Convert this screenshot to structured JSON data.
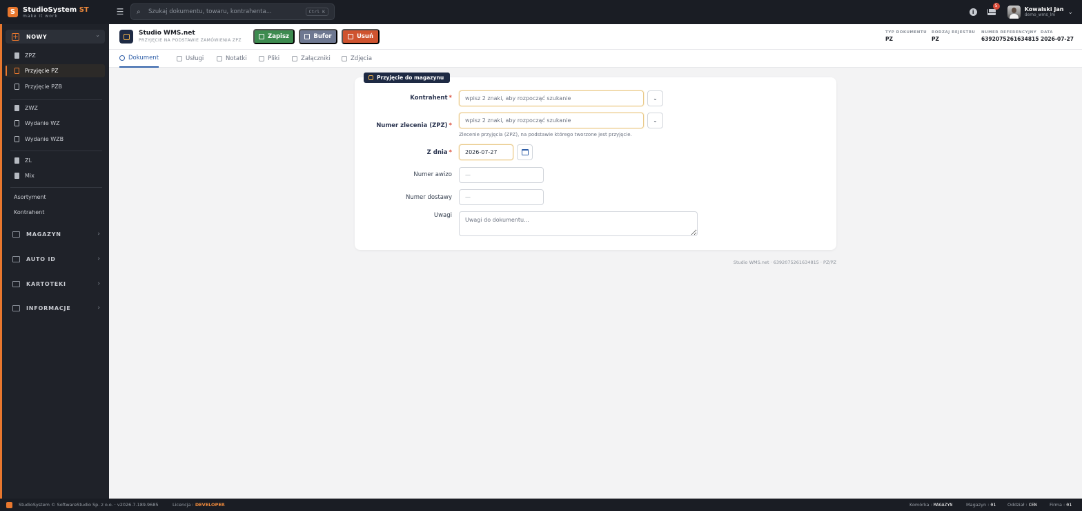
{
  "app": {
    "brand_name": "StudioSystem",
    "brand_accent": "ST",
    "brand_tagline": "make it work",
    "logo_letter": "S"
  },
  "topbar": {
    "search_placeholder": "Szukaj dokumentu, towaru, kontrahenta...",
    "search_shortcut": "Ctrl K",
    "notification_count": "5",
    "user_name": "Kowalski Jan",
    "user_login": "demo_wms_lm"
  },
  "sidebar": {
    "new_section": "NOWY",
    "items": [
      {
        "label": "ZPZ"
      },
      {
        "label": "Przyjęcie PZ"
      },
      {
        "label": "Przyjęcie PZB"
      },
      {
        "label": "ZWZ"
      },
      {
        "label": "Wydanie WZ"
      },
      {
        "label": "Wydanie WZB"
      },
      {
        "label": "ZL"
      },
      {
        "label": "Mix"
      }
    ],
    "plain_items": [
      {
        "label": "Asortyment"
      },
      {
        "label": "Kontrahent"
      }
    ],
    "groups": [
      {
        "label": "MAGAZYN"
      },
      {
        "label": "AUTO ID"
      },
      {
        "label": "KARTOTEKI"
      },
      {
        "label": "INFORMACJE"
      }
    ]
  },
  "document": {
    "title": "Studio WMS.net",
    "subtitle": "PRZYJĘCIE NA PODSTAWIE ZAMÓWIENIA ZPZ",
    "buttons": {
      "save": "Zapisz",
      "buffer": "Bufor",
      "delete": "Usuń"
    },
    "meta": [
      {
        "label": "TYP DOKUMENTU",
        "value": "PZ"
      },
      {
        "label": "RODZAJ REJESTRU",
        "value": "PZ"
      },
      {
        "label": "NUMER REFERENCYJNY",
        "value": "6392075261634815"
      },
      {
        "label": "DATA",
        "value": "2026-07-27"
      }
    ]
  },
  "tabs": [
    {
      "label": "Dokument"
    },
    {
      "label": "Usługi"
    },
    {
      "label": "Notatki"
    },
    {
      "label": "Pliki"
    },
    {
      "label": "Załączniki"
    },
    {
      "label": "Zdjęcia"
    }
  ],
  "form": {
    "card_title": "Przyjęcie do magazynu",
    "contractor_label": "Kontrahent",
    "contractor_placeholder": "wpisz 2 znaki, aby rozpocząć szukanie",
    "order_label": "Numer zlecenia (ZPZ)",
    "order_placeholder": "wpisz 2 znaki, aby rozpocząć szukanie",
    "order_help": "Zlecenie przyjęcia (ZPZ), na podstawie którego tworzone jest przyjęcie.",
    "date_label": "Z dnia",
    "date_value": "2026-07-27",
    "advice_label": "Numer awizo",
    "advice_placeholder": "—",
    "delivery_label": "Numer dostawy",
    "delivery_placeholder": "—",
    "notes_label": "Uwagi",
    "notes_placeholder": "Uwagi do dokumentu...",
    "required_mark": "*"
  },
  "footer_note": "Studio WMS.net · 6392075261634815 · PZ/PZ",
  "statusbar": {
    "copyright": "StudioSystem © SoftwareStudio Sp. z o.o. · v2026.7.189.9685",
    "license_label": "Licencja :",
    "license_value": "DEVELOPER",
    "cell_label": "Komórka :",
    "cell_value": "MAGAZYN",
    "warehouse_label": "Magazyn :",
    "warehouse_value": "01",
    "branch_label": "Oddział :",
    "branch_value": "CEN",
    "company_label": "Firma :",
    "company_value": "01"
  },
  "colors": {
    "accent_orange": "#e8772e",
    "save_green": "#3d8b4f",
    "buffer_gray": "#6e7891",
    "delete_red": "#cf532f",
    "tab_active_blue": "#2f5fa8",
    "navy": "#1e2a44"
  }
}
